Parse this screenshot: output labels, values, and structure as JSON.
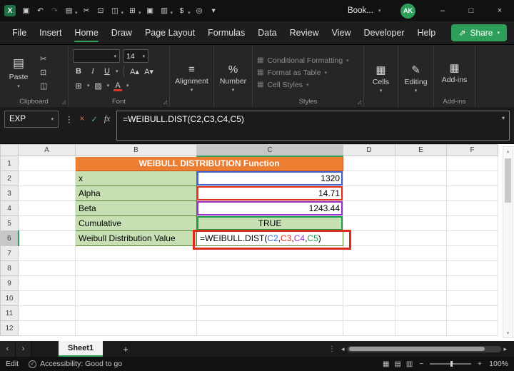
{
  "theme": {
    "accent": "#2E9E5B",
    "excel_green": "#1E7145"
  },
  "icons": {
    "chevron": "▾",
    "launcher": "◿",
    "paste": "▤",
    "cut": "✂",
    "copy": "⊡",
    "format_painter": "◫",
    "borders": "⊞",
    "fill_color": "▨",
    "font_color_a": "A",
    "grow_font": "A▴",
    "shrink_font": "A▾",
    "align": "≡",
    "percent": "%",
    "grid": "▦",
    "pencil": "✎",
    "cancel": "×",
    "enter": "✓",
    "fx": "fx",
    "dots": "⋮",
    "nav_left": "‹",
    "nav_right": "›",
    "scroll_left": "◂",
    "scroll_right": "▸",
    "scroll_up": "▴",
    "scroll_down": "▾",
    "minus": "−",
    "plus": "+",
    "share_arrow": "⇗",
    "acc_check": "✓"
  },
  "titlebar": {
    "doc_title": "Book...",
    "avatar": "AK",
    "window": {
      "minimize": "–",
      "maximize": "□",
      "close": "×"
    },
    "qat": [
      {
        "name": "excel-logo",
        "glyph": "X",
        "logo": true
      },
      {
        "name": "save-icon",
        "glyph": "▣"
      },
      {
        "name": "undo-icon",
        "glyph": "↶"
      },
      {
        "name": "redo-icon",
        "glyph": "↷",
        "dim": true
      },
      {
        "name": "paste-icon",
        "glyph": "▤",
        "chev": true
      },
      {
        "name": "cut-icon",
        "glyph": "✂"
      },
      {
        "name": "copy-icon",
        "glyph": "⊡"
      },
      {
        "name": "format-painter-icon",
        "glyph": "◫",
        "chev": true
      },
      {
        "name": "table-icon",
        "glyph": "⊞",
        "chev": true
      },
      {
        "name": "image-icon",
        "glyph": "▣"
      },
      {
        "name": "chart-icon",
        "glyph": "▥",
        "chev": true
      },
      {
        "name": "currency-icon",
        "glyph": "$",
        "chev": true
      },
      {
        "name": "record-macro-icon",
        "glyph": "◎"
      },
      {
        "name": "more-commands-icon",
        "glyph": "▾"
      }
    ]
  },
  "menubar": {
    "items": [
      "File",
      "Insert",
      "Home",
      "Draw",
      "Page Layout",
      "Formulas",
      "Data",
      "Review",
      "View",
      "Developer",
      "Help"
    ],
    "active_index": 2,
    "share_label": "Share"
  },
  "ribbon": {
    "paste": "Paste",
    "clipboard_group": "Clipboard",
    "font_group": "Font",
    "font_size": "14",
    "bold": "B",
    "italic": "I",
    "underline": "U",
    "alignment": "Alignment",
    "number": "Number",
    "styles_group": "Styles",
    "styles_items": [
      "Conditional Formatting",
      "Format as Table",
      "Cell Styles"
    ],
    "cells": "Cells",
    "editing": "Editing",
    "addins": "Add-ins",
    "addins_group": "Add-ins"
  },
  "formula_bar": {
    "name_box": "EXP",
    "formula": "=WEIBULL.DIST(C2,C3,C4,C5)"
  },
  "grid": {
    "columns": [
      "A",
      "B",
      "C",
      "D",
      "E",
      "F"
    ],
    "num_rows": 12,
    "selected_column": "C",
    "selected_row": 6,
    "title": "WEIBULL DISTRIBUTION Function",
    "colors": {
      "title_bg": "#ED7D31",
      "title_text": "#FFFFFF",
      "title_border": "#C0561B",
      "label_bg": "#C6E0B4",
      "label_border": "#548235",
      "ref_blue": "#3F63D2",
      "ref_red": "#E0321E",
      "ref_purple": "#9B30C8",
      "ref_green": "#1E9E48",
      "annotation": "#D92B1C"
    },
    "rows": [
      {
        "row": 2,
        "label": "x",
        "value": "1320",
        "ref": "ref_blue",
        "align": "right"
      },
      {
        "row": 3,
        "label": "Alpha",
        "value": "14.71",
        "ref": "ref_red",
        "align": "right"
      },
      {
        "row": 4,
        "label": "Beta",
        "value": "1243.44",
        "ref": "ref_purple",
        "align": "right"
      },
      {
        "row": 5,
        "label": "Cumulative",
        "value": "TRUE",
        "ref": "ref_green",
        "align": "center",
        "fill": true
      },
      {
        "row": 6,
        "label": "Weibull Distribution Value",
        "formula": true
      }
    ],
    "formula_parts": [
      {
        "text": "=WEIBULL.DIST(",
        "color": "#000000"
      },
      {
        "text": "C2",
        "color": "#3F63D2"
      },
      {
        "text": ",",
        "color": "#000000"
      },
      {
        "text": "C3",
        "color": "#E0321E"
      },
      {
        "text": ",",
        "color": "#000000"
      },
      {
        "text": "C4",
        "color": "#9B30C8"
      },
      {
        "text": ",",
        "color": "#000000"
      },
      {
        "text": "C5",
        "color": "#1E9E48"
      },
      {
        "text": ")",
        "color": "#000000"
      }
    ]
  },
  "sheetbar": {
    "tab": "Sheet1",
    "add": "+"
  },
  "statusbar": {
    "mode": "Edit",
    "accessibility": "Accessibility: Good to go",
    "zoom": "100%",
    "views": [
      "▦",
      "▤",
      "▥"
    ]
  }
}
